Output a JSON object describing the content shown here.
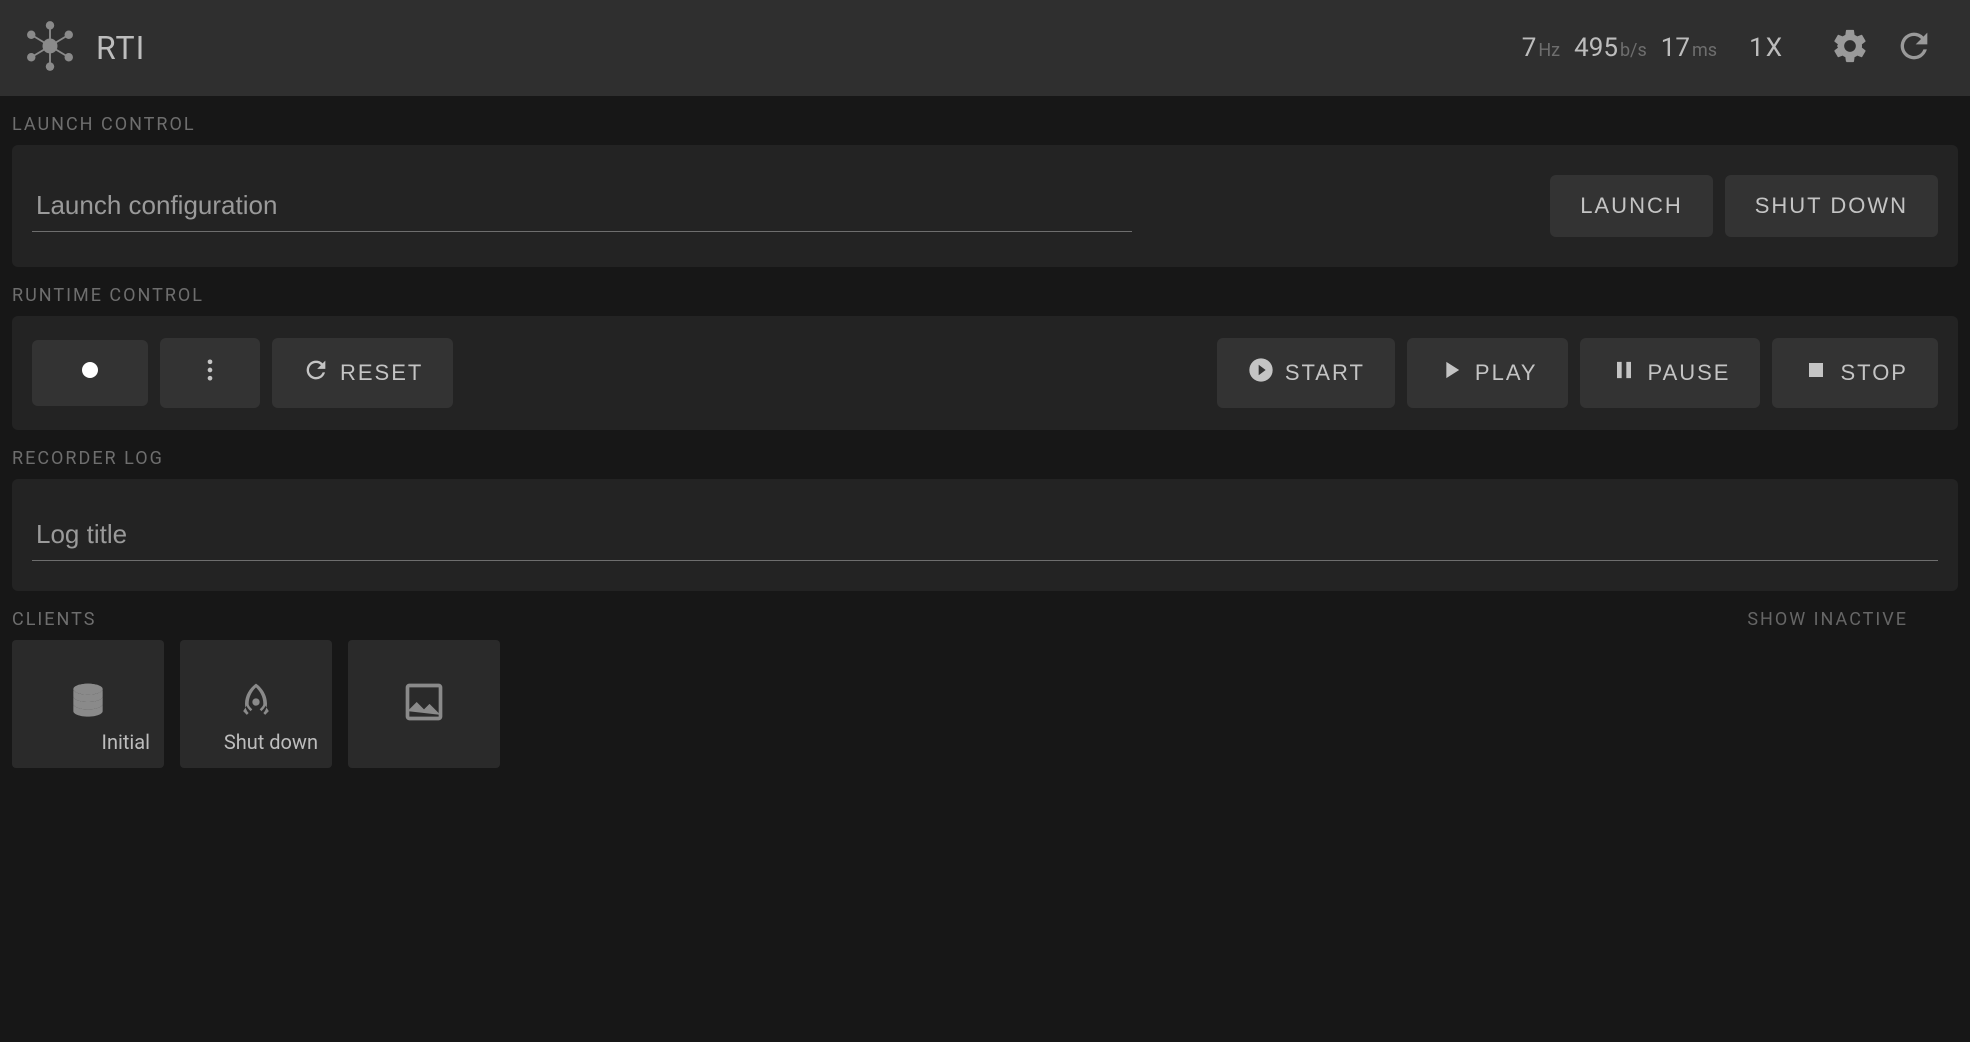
{
  "header": {
    "app_title": "RTI",
    "stats": {
      "hz_value": "7",
      "hz_unit": "Hz",
      "bps_value": "495",
      "bps_unit": "b/s",
      "ms_value": "17",
      "ms_unit": "ms"
    },
    "speed": "1X"
  },
  "launch": {
    "section_title": "LAUNCH CONTROL",
    "config_placeholder": "Launch configuration",
    "config_value": "",
    "launch_label": "LAUNCH",
    "shutdown_label": "SHUT DOWN"
  },
  "runtime": {
    "section_title": "RUNTIME CONTROL",
    "reset_label": "RESET",
    "start_label": "START",
    "play_label": "PLAY",
    "pause_label": "PAUSE",
    "stop_label": "STOP"
  },
  "recorder": {
    "section_title": "RECORDER LOG",
    "title_placeholder": "Log title",
    "title_value": ""
  },
  "clients": {
    "section_title": "CLIENTS",
    "show_inactive_label": "SHOW INACTIVE",
    "items": [
      {
        "label": "Initial",
        "icon": "database"
      },
      {
        "label": "Shut down",
        "icon": "rocket"
      },
      {
        "label": "",
        "icon": "image"
      }
    ]
  }
}
